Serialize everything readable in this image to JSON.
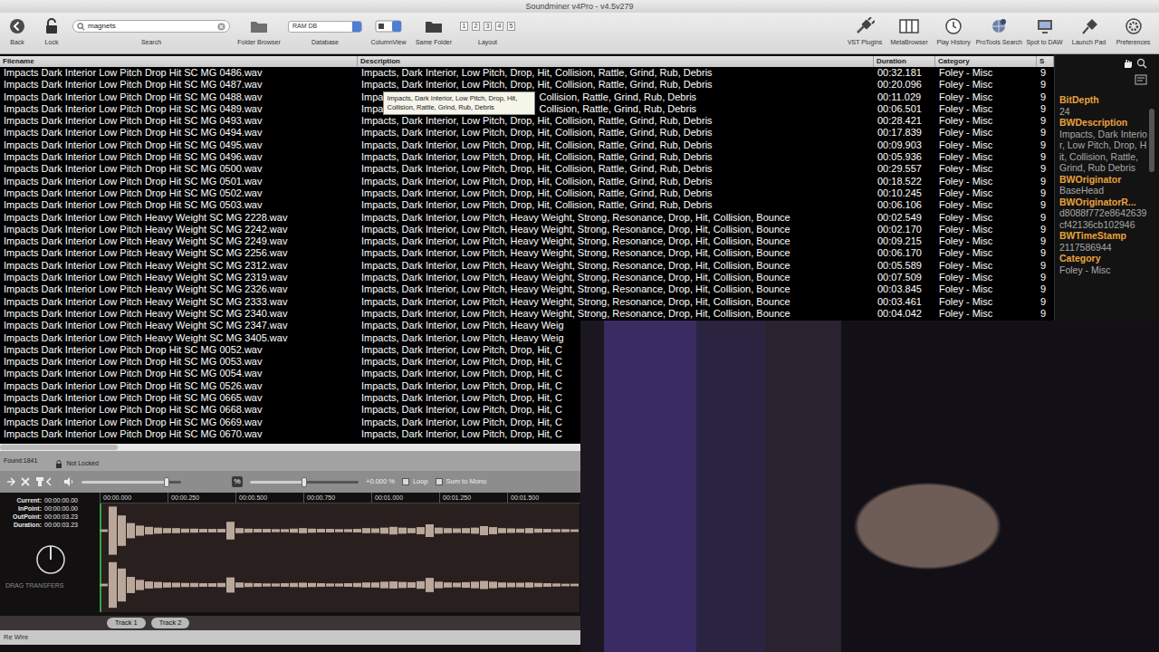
{
  "window": {
    "title": "Soundminer v4Pro - v4.5v279"
  },
  "toolbar": {
    "left": [
      {
        "label": "Back",
        "kind": "back"
      },
      {
        "label": "Lock",
        "kind": "lock"
      }
    ],
    "search": {
      "label": "Search",
      "value": "magnets"
    },
    "middle": [
      {
        "label": "Folder Browser",
        "kind": "folder"
      }
    ],
    "database": {
      "label": "Database",
      "value": "RAM DB"
    },
    "view": [
      {
        "label": "ColumnView",
        "kind": "columnview"
      },
      {
        "label": "Same Folder",
        "kind": "samefolder"
      }
    ],
    "layout": {
      "label": "Layout",
      "buttons": [
        "1",
        "2",
        "3",
        "4",
        "5"
      ]
    },
    "right": [
      {
        "label": "VST Plugins",
        "kind": "plug"
      },
      {
        "label": "MetaBrowser",
        "kind": "columns"
      },
      {
        "label": "Play History",
        "kind": "clock"
      },
      {
        "label": "ProTools Search",
        "kind": "globe"
      },
      {
        "label": "Spot to DAW",
        "kind": "spot"
      },
      {
        "label": "Launch Pad",
        "kind": "pin"
      },
      {
        "label": "Preferences",
        "kind": "gear"
      }
    ]
  },
  "table": {
    "columns": [
      "Filename",
      "Description",
      "Duration",
      "Category",
      "S"
    ],
    "tooltip": {
      "text": "Impacts, Dark Interior, Low Pitch, Drop, Hit, Collision, Rattle, Grind, Rub, Debris"
    },
    "rows": [
      {
        "filename": "Impacts Dark Interior Low Pitch Drop Hit SC MG 0486.wav",
        "description": "Impacts, Dark Interior, Low Pitch, Drop, Hit, Collision, Rattle, Grind, Rub, Debris",
        "duration": "00:32.181",
        "category": "Foley - Misc",
        "s": "9"
      },
      {
        "filename": "Impacts Dark Interior Low Pitch Drop Hit SC MG 0487.wav",
        "description": "Impacts, Dark Interior, Low Pitch, Drop, Hit, Collision, Rattle, Grind, Rub, Debris",
        "duration": "00:20.096",
        "category": "Foley - Misc",
        "s": "9"
      },
      {
        "filename": "Impacts Dark Interior Low Pitch Drop Hit SC MG 0488.wav",
        "description": "Impa",
        "description_tail": "Collision, Rattle, Grind, Rub, Debris",
        "duration": "00:11.029",
        "category": "Foley - Misc",
        "s": "9"
      },
      {
        "filename": "Impacts Dark Interior Low Pitch Drop Hit SC MG 0489.wav",
        "description": "Impa",
        "description_tail": "Collision, Rattle, Grind, Rub, Debris",
        "duration": "00:06.501",
        "category": "Foley - Misc",
        "s": "9"
      },
      {
        "filename": "Impacts Dark Interior Low Pitch Drop Hit SC MG 0493.wav",
        "description": "Impacts, Dark Interior, Low Pitch, Drop, Hit, Collision, Rattle, Grind, Rub, Debris",
        "duration": "00:28.421",
        "category": "Foley - Misc",
        "s": "9"
      },
      {
        "filename": "Impacts Dark Interior Low Pitch Drop Hit SC MG 0494.wav",
        "description": "Impacts, Dark Interior, Low Pitch, Drop, Hit, Collision, Rattle, Grind, Rub, Debris",
        "duration": "00:17.839",
        "category": "Foley - Misc",
        "s": "9"
      },
      {
        "filename": "Impacts Dark Interior Low Pitch Drop Hit SC MG 0495.wav",
        "description": "Impacts, Dark Interior, Low Pitch, Drop, Hit, Collision, Rattle, Grind, Rub, Debris",
        "duration": "00:09.903",
        "category": "Foley - Misc",
        "s": "9"
      },
      {
        "filename": "Impacts Dark Interior Low Pitch Drop Hit SC MG 0496.wav",
        "description": "Impacts, Dark Interior, Low Pitch, Drop, Hit, Collision, Rattle, Grind, Rub, Debris",
        "duration": "00:05.936",
        "category": "Foley - Misc",
        "s": "9"
      },
      {
        "filename": "Impacts Dark Interior Low Pitch Drop Hit SC MG 0500.wav",
        "description": "Impacts, Dark Interior, Low Pitch, Drop, Hit, Collision, Rattle, Grind, Rub, Debris",
        "duration": "00:29.557",
        "category": "Foley - Misc",
        "s": "9"
      },
      {
        "filename": "Impacts Dark Interior Low Pitch Drop Hit SC MG 0501.wav",
        "description": "Impacts, Dark Interior, Low Pitch, Drop, Hit, Collision, Rattle, Grind, Rub, Debris",
        "duration": "00:18.522",
        "category": "Foley - Misc",
        "s": "9"
      },
      {
        "filename": "Impacts Dark Interior Low Pitch Drop Hit SC MG 0502.wav",
        "description": "Impacts, Dark Interior, Low Pitch, Drop, Hit, Collision, Rattle, Grind, Rub, Debris",
        "duration": "00:10.245",
        "category": "Foley - Misc",
        "s": "9"
      },
      {
        "filename": "Impacts Dark Interior Low Pitch Drop Hit SC MG 0503.wav",
        "description": "Impacts, Dark Interior, Low Pitch, Drop, Hit, Collision, Rattle, Grind, Rub, Debris",
        "duration": "00:06.106",
        "category": "Foley - Misc",
        "s": "9"
      },
      {
        "filename": "Impacts Dark Interior Low Pitch Heavy Weight SC MG 2228.wav",
        "description": "Impacts, Dark Interior, Low Pitch, Heavy Weight, Strong, Resonance, Drop, Hit, Collision, Bounce",
        "duration": "00:02.549",
        "category": "Foley - Misc",
        "s": "9"
      },
      {
        "filename": "Impacts Dark Interior Low Pitch Heavy Weight SC MG 2242.wav",
        "description": "Impacts, Dark Interior, Low Pitch, Heavy Weight, Strong, Resonance, Drop, Hit, Collision, Bounce",
        "duration": "00:02.170",
        "category": "Foley - Misc",
        "s": "9"
      },
      {
        "filename": "Impacts Dark Interior Low Pitch Heavy Weight SC MG 2249.wav",
        "description": "Impacts, Dark Interior, Low Pitch, Heavy Weight, Strong, Resonance, Drop, Hit, Collision, Bounce",
        "duration": "00:09.215",
        "category": "Foley - Misc",
        "s": "9"
      },
      {
        "filename": "Impacts Dark Interior Low Pitch Heavy Weight SC MG 2256.wav",
        "description": "Impacts, Dark Interior, Low Pitch, Heavy Weight, Strong, Resonance, Drop, Hit, Collision, Bounce",
        "duration": "00:06.170",
        "category": "Foley - Misc",
        "s": "9"
      },
      {
        "filename": "Impacts Dark Interior Low Pitch Heavy Weight SC MG 2312.wav",
        "description": "Impacts, Dark Interior, Low Pitch, Heavy Weight, Strong, Resonance, Drop, Hit, Collision, Bounce",
        "duration": "00:05.589",
        "category": "Foley - Misc",
        "s": "9"
      },
      {
        "filename": "Impacts Dark Interior Low Pitch Heavy Weight SC MG 2319.wav",
        "description": "Impacts, Dark Interior, Low Pitch, Heavy Weight, Strong, Resonance, Drop, Hit, Collision, Bounce",
        "duration": "00:07.509",
        "category": "Foley - Misc",
        "s": "9"
      },
      {
        "filename": "Impacts Dark Interior Low Pitch Heavy Weight SC MG 2326.wav",
        "description": "Impacts, Dark Interior, Low Pitch, Heavy Weight, Strong, Resonance, Drop, Hit, Collision, Bounce",
        "duration": "00:03.845",
        "category": "Foley - Misc",
        "s": "9"
      },
      {
        "filename": "Impacts Dark Interior Low Pitch Heavy Weight SC MG 2333.wav",
        "description": "Impacts, Dark Interior, Low Pitch, Heavy Weight, Strong, Resonance, Drop, Hit, Collision, Bounce",
        "duration": "00:03.461",
        "category": "Foley - Misc",
        "s": "9"
      },
      {
        "filename": "Impacts Dark Interior Low Pitch Heavy Weight SC MG 2340.wav",
        "description": "Impacts, Dark Interior, Low Pitch, Heavy Weight, Strong, Resonance, Drop, Hit, Collision, Bounce",
        "duration": "00:04.042",
        "category": "Foley - Misc",
        "s": "9"
      },
      {
        "filename": "Impacts Dark Interior Low Pitch Heavy Weight SC MG 2347.wav",
        "description": "Impacts, Dark Interior, Low Pitch, Heavy Weig"
      },
      {
        "filename": "Impacts Dark Interior Low Pitch Heavy Weight SC MG 3405.wav",
        "description": "Impacts, Dark Interior, Low Pitch, Heavy Weig"
      },
      {
        "filename": "Impacts Dark Interior Low Pitch Drop Hit SC MG 0052.wav",
        "description": "Impacts, Dark Interior, Low Pitch, Drop, Hit, C"
      },
      {
        "filename": "Impacts Dark Interior Low Pitch Drop Hit SC MG 0053.wav",
        "description": "Impacts, Dark Interior, Low Pitch, Drop, Hit, C"
      },
      {
        "filename": "Impacts Dark Interior Low Pitch Drop Hit SC MG 0054.wav",
        "description": "Impacts, Dark Interior, Low Pitch, Drop, Hit, C"
      },
      {
        "filename": "Impacts Dark Interior Low Pitch Drop Hit SC MG 0526.wav",
        "description": "Impacts, Dark Interior, Low Pitch, Drop, Hit, C"
      },
      {
        "filename": "Impacts Dark Interior Low Pitch Drop Hit SC MG 0665.wav",
        "description": "Impacts, Dark Interior, Low Pitch, Drop, Hit, C"
      },
      {
        "filename": "Impacts Dark Interior Low Pitch Drop Hit SC MG 0668.wav",
        "description": "Impacts, Dark Interior, Low Pitch, Drop, Hit, C"
      },
      {
        "filename": "Impacts Dark Interior Low Pitch Drop Hit SC MG 0669.wav",
        "description": "Impacts, Dark Interior, Low Pitch, Drop, Hit, C"
      },
      {
        "filename": "Impacts Dark Interior Low Pitch Drop Hit SC MG 0670.wav",
        "description": "Impacts, Dark Interior, Low Pitch, Drop, Hit, C"
      }
    ]
  },
  "metadata": {
    "fields": [
      {
        "label": "BitDepth",
        "value": "24"
      },
      {
        "label": "BWDescription",
        "value": "Impacts, Dark Interior, Low Pitch, Drop, Hit, Collision, Rattle, Grind, Rub Debris"
      },
      {
        "label": "BWOriginator",
        "value": "BaseHead"
      },
      {
        "label": "BWOriginatorR...",
        "value": "d8088f772e8642639cf42136cb102946"
      },
      {
        "label": "BWTimeStamp",
        "value": "2117586944"
      },
      {
        "label": "Category",
        "value": "Foley - Misc"
      }
    ]
  },
  "player": {
    "found": "Found:1841",
    "lock": "Not Locked",
    "volume": {
      "level": 0.85
    },
    "percent_button": "%",
    "pitch": {
      "level": 0.5,
      "reading": "+0.000 %"
    },
    "loop": {
      "label": "Loop",
      "checked": false
    },
    "sum_to_mono": {
      "label": "Sum to Mono",
      "checked": false
    },
    "times": [
      {
        "label": "Current:",
        "value": "00:00:00.00"
      },
      {
        "label": "InPoint:",
        "value": "00:00:00.00"
      },
      {
        "label": "OutPoint:",
        "value": "00:00:03.23"
      },
      {
        "label": "Duration:",
        "value": "00:00:03.23"
      }
    ],
    "drag_label": "DRAG TRANSFERS",
    "ruler": [
      "00:00.000",
      "00:00.250",
      "00:00.500",
      "00:00.750",
      "00:01.000",
      "00:01.250",
      "00:01.500"
    ],
    "waveform": {
      "channels": [
        [
          0.05,
          0.95,
          0.6,
          0.3,
          0.2,
          0.15,
          0.12,
          0.1,
          0.1,
          0.08,
          0.08,
          0.07,
          0.07,
          0.07,
          0.35,
          0.1,
          0.08,
          0.07,
          0.07,
          0.06,
          0.06,
          0.08,
          0.1,
          0.08,
          0.07,
          0.07,
          0.06,
          0.06,
          0.07,
          0.1,
          0.09,
          0.12,
          0.15,
          0.12,
          0.1,
          0.14,
          0.25,
          0.12,
          0.1,
          0.09,
          0.1,
          0.12,
          0.18,
          0.14,
          0.1,
          0.09,
          0.08,
          0.1,
          0.08,
          0.07,
          0.06,
          0.06,
          0.05
        ],
        [
          0.05,
          0.9,
          0.65,
          0.32,
          0.2,
          0.14,
          0.12,
          0.1,
          0.09,
          0.08,
          0.08,
          0.07,
          0.07,
          0.08,
          0.3,
          0.1,
          0.08,
          0.07,
          0.06,
          0.06,
          0.07,
          0.08,
          0.09,
          0.08,
          0.07,
          0.06,
          0.06,
          0.07,
          0.08,
          0.1,
          0.1,
          0.13,
          0.14,
          0.12,
          0.11,
          0.15,
          0.28,
          0.13,
          0.1,
          0.09,
          0.11,
          0.13,
          0.16,
          0.13,
          0.1,
          0.09,
          0.09,
          0.1,
          0.08,
          0.07,
          0.06,
          0.05,
          0.05
        ]
      ]
    },
    "tracks": [
      {
        "label": "Track 1"
      },
      {
        "label": "Track 2"
      }
    ],
    "rewire": "Re Wire"
  }
}
